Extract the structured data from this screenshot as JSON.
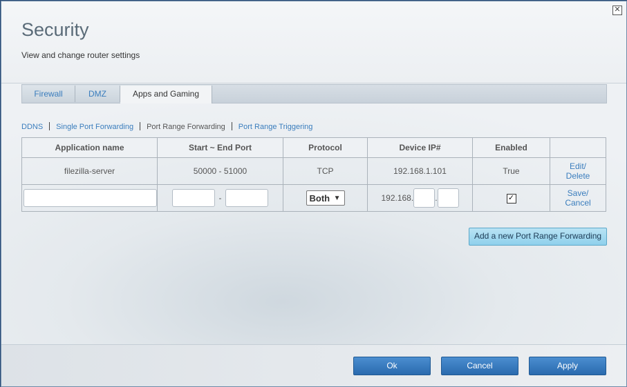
{
  "header": {
    "title": "Security",
    "subtitle": "View and change router settings"
  },
  "tabs": [
    {
      "label": "Firewall"
    },
    {
      "label": "DMZ"
    },
    {
      "label": "Apps and Gaming"
    }
  ],
  "subnav": [
    {
      "label": "DDNS"
    },
    {
      "label": "Single Port Forwarding"
    },
    {
      "label": "Port Range Forwarding"
    },
    {
      "label": "Port Range Triggering"
    }
  ],
  "table": {
    "columns": [
      "Application name",
      "Start ~ End Port",
      "Protocol",
      "Device IP#",
      "Enabled",
      ""
    ],
    "rows": [
      {
        "app": "filezilla-server",
        "ports": "50000 - 51000",
        "protocol": "TCP",
        "ip": "192.168.1.101",
        "enabled": "True",
        "edit": "Edit/",
        "delete": "Delete"
      }
    ],
    "edit_row": {
      "port_separator": "-",
      "protocol": "Both",
      "ip_prefix": "192.168.",
      "ip_dot": ".",
      "enabled_check": "✓",
      "save": "Save/",
      "cancel": "Cancel"
    }
  },
  "add_button": "Add a new Port Range Forwarding",
  "footer": {
    "ok": "Ok",
    "cancel": "Cancel",
    "apply": "Apply"
  },
  "icons": {
    "close": "close-icon"
  }
}
